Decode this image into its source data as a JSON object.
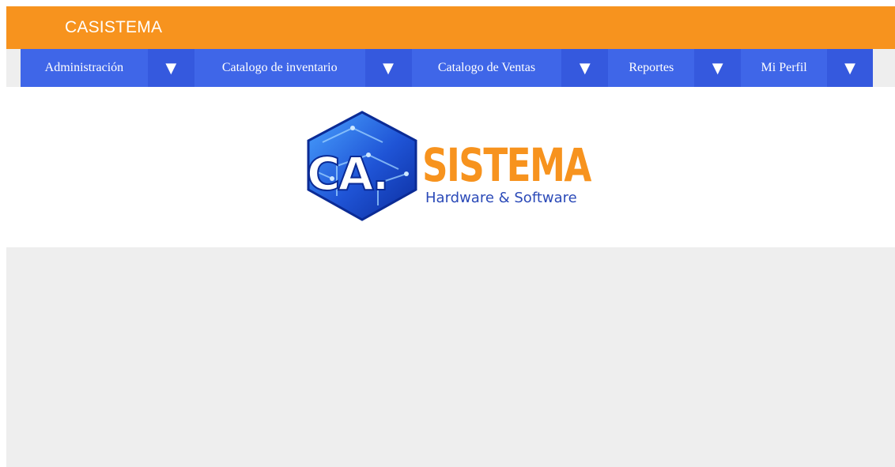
{
  "header": {
    "title": "CASISTEMA"
  },
  "menu": {
    "items": [
      {
        "label": "Administración",
        "icon": "triangle-down-icon"
      },
      {
        "label": "Catalogo de inventario",
        "icon": "triangle-down-icon"
      },
      {
        "label": "Catalogo de Ventas",
        "icon": "triangle-down-icon"
      },
      {
        "label": "Reportes",
        "icon": "triangle-down-icon"
      },
      {
        "label": "Mi Perfil",
        "icon": "triangle-down-icon"
      }
    ],
    "toggle_glyph": "▼"
  },
  "logo": {
    "initials": "CA.",
    "name": "SISTEMA",
    "tagline": "Hardware & Software"
  },
  "colors": {
    "header_bg": "#f7931e",
    "menu_bg": "#3f66e8",
    "menu_toggle_bg": "#3559de",
    "page_bg": "#eeeeee",
    "logo_orange": "#f7931e",
    "logo_blue": "#2b4ab8"
  }
}
